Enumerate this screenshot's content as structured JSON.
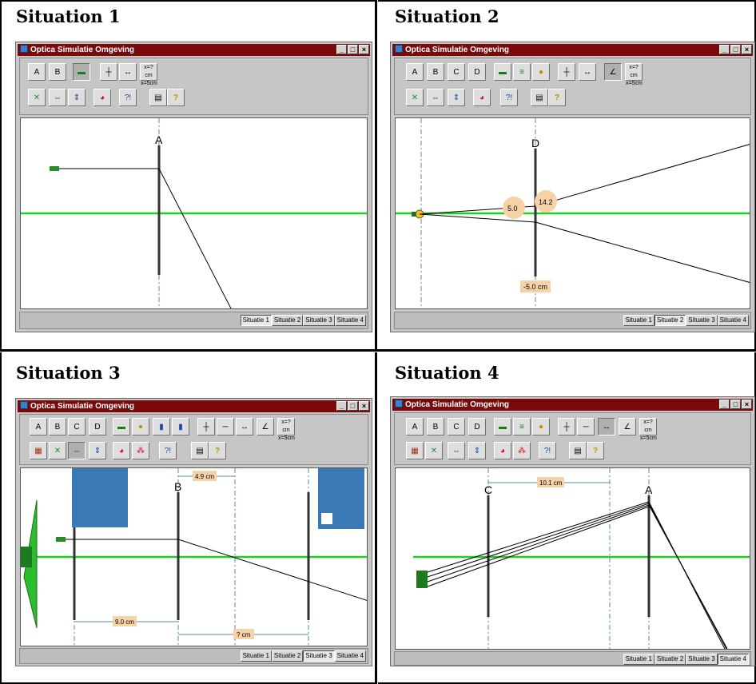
{
  "app_title": "Optica Simulatie Omgeving",
  "window_buttons": [
    "_",
    "□",
    "×"
  ],
  "status_tabs": [
    "Situatie 1",
    "Situatie 2",
    "Situatie 3",
    "Situatie 4"
  ],
  "situations": [
    {
      "title": "Situation 1",
      "active_tab": 0,
      "labels": {
        "lens": "A"
      }
    },
    {
      "title": "Situation 2",
      "active_tab": 1,
      "labels": {
        "lens": "D",
        "m1": "5.0",
        "m2": "14.2",
        "m3": "-5.0 cm"
      }
    },
    {
      "title": "Situation 3",
      "active_tab": 2,
      "labels": {
        "lens_b": "B",
        "d1": "4.9 cm",
        "d2": "9.0 cm",
        "d3": "? cm"
      }
    },
    {
      "title": "Situation 4",
      "active_tab": 3,
      "labels": {
        "lens_c": "C",
        "lens_a": "A",
        "d1": "10.1 cm"
      }
    }
  ],
  "tool_labels": {
    "lens_a": "A",
    "lens_b": "B",
    "lens_c": "C",
    "lens_d": "D",
    "measure": "x=?cm",
    "measure2": "x=5cm"
  },
  "colors": {
    "axis": "#22cc22",
    "title_bar": "#7a0a0a",
    "label_bg": "#f7d2a6",
    "blue_screen": "#3a79b6",
    "green_obj": "#2a8a2a"
  }
}
